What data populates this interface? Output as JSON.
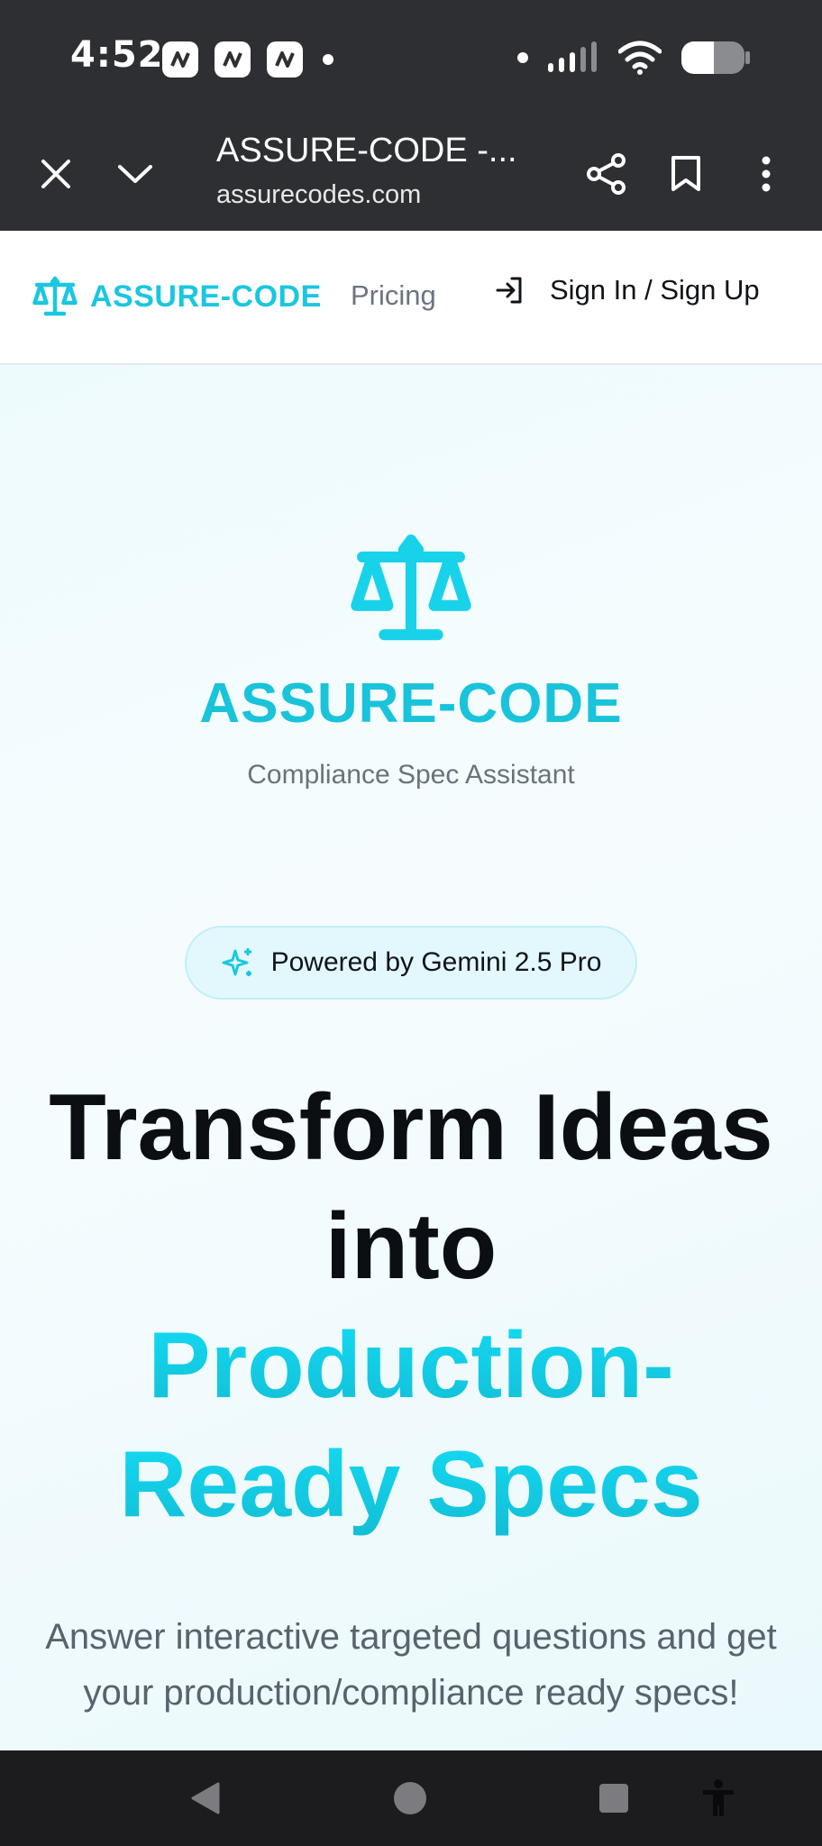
{
  "status_bar": {
    "time": "4:52"
  },
  "browser": {
    "page_title": "ASSURE-CODE -...",
    "domain": "assurecodes.com"
  },
  "header": {
    "brand": "ASSURE-CODE",
    "nav_pricing": "Pricing",
    "sign_in_label": "Sign In / Sign Up"
  },
  "hero": {
    "brand": "ASSURE-CODE",
    "tagline": "Compliance Spec Assistant",
    "badge_label": "Powered by Gemini 2.5 Pro",
    "headline_line1": "Transform Ideas",
    "headline_line2": "into",
    "headline_accent1": "Production-",
    "headline_accent2": "Ready Specs",
    "description": "Answer interactive targeted questions and get your production/compliance ready specs!"
  },
  "colors": {
    "accent": "#1bc6e0",
    "chrome": "#2d2f33"
  },
  "icons": {
    "header_logo": "scale-icon",
    "hero_logo": "scale-icon",
    "badge": "sparkle-icon",
    "sign_in": "login-icon"
  }
}
